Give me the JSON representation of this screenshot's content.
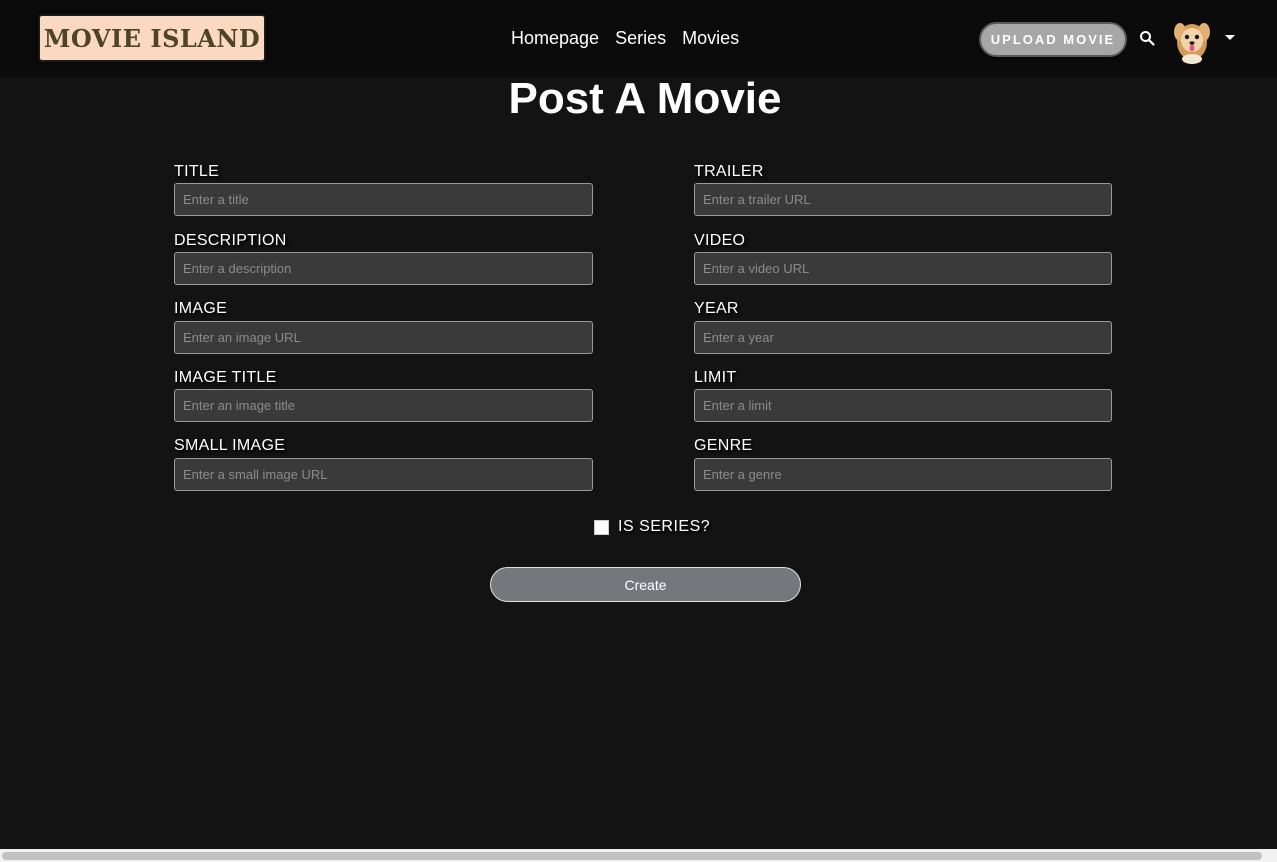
{
  "nav": {
    "logo_text": "MOVIE ISLAND",
    "links": [
      "Homepage",
      "Series",
      "Movies"
    ],
    "upload_label": "UPLOAD MOVIE",
    "search_icon": "search-icon",
    "avatar_icon": "avatar",
    "menu_icon": "caret-down-icon"
  },
  "page": {
    "title": "Post A Movie"
  },
  "form": {
    "left": [
      {
        "label": "TITLE",
        "placeholder": "Enter a title"
      },
      {
        "label": "DESCRIPTION",
        "placeholder": "Enter a description"
      },
      {
        "label": "IMAGE",
        "placeholder": "Enter an image URL"
      },
      {
        "label": "IMAGE TITLE",
        "placeholder": "Enter an image title"
      },
      {
        "label": "SMALL IMAGE",
        "placeholder": "Enter a small image URL"
      }
    ],
    "right": [
      {
        "label": "TRAILER",
        "placeholder": "Enter a trailer URL"
      },
      {
        "label": "VIDEO",
        "placeholder": "Enter a video URL"
      },
      {
        "label": "YEAR",
        "placeholder": "Enter a year"
      },
      {
        "label": "LIMIT",
        "placeholder": "Enter a limit"
      },
      {
        "label": "GENRE",
        "placeholder": "Enter a genre"
      }
    ],
    "series_label": "IS SERIES?",
    "series_checked": false,
    "submit_label": "Create"
  },
  "colors": {
    "background": "#131313",
    "navbar": "#0b0b0b",
    "logo_bg": "#fbd9c0",
    "input_bg": "#3a3a3a",
    "button_bg": "#74777c"
  }
}
